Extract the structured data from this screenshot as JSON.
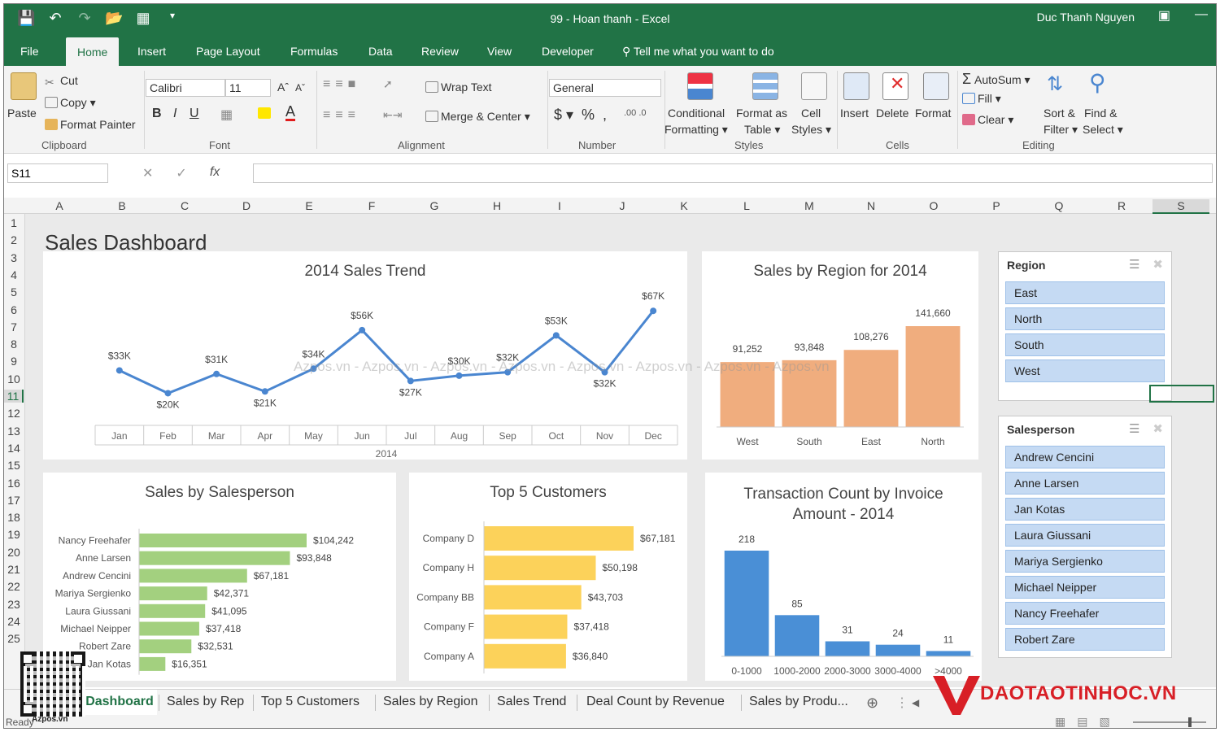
{
  "window": {
    "title": "99 - Hoan thanh - Excel",
    "user": "Duc Thanh Nguyen"
  },
  "ribbon_tabs": [
    "File",
    "Home",
    "Insert",
    "Page Layout",
    "Formulas",
    "Data",
    "Review",
    "View",
    "Developer"
  ],
  "tell_me": "Tell me what you want to do",
  "ribbon": {
    "paste": "Paste",
    "cut": "Cut",
    "copy": "Copy",
    "format_painter": "Format Painter",
    "clipboard": "Clipboard",
    "font_name": "Calibri",
    "font_size": "11",
    "font": "Font",
    "wrap_text": "Wrap Text",
    "merge_center": "Merge & Center",
    "alignment": "Alignment",
    "number_format": "General",
    "number": "Number",
    "conditional_formatting_1": "Conditional",
    "conditional_formatting_2": "Formatting",
    "format_as_table_1": "Format as",
    "format_as_table_2": "Table",
    "cell_styles_1": "Cell",
    "cell_styles_2": "Styles",
    "styles": "Styles",
    "insert": "Insert",
    "delete": "Delete",
    "format": "Format",
    "cells": "Cells",
    "autosum": "AutoSum",
    "fill": "Fill",
    "clear": "Clear",
    "sort_filter_1": "Sort &",
    "sort_filter_2": "Filter",
    "find_select_1": "Find &",
    "find_select_2": "Select",
    "editing": "Editing"
  },
  "formula_bar": {
    "name_box": "S11",
    "fx": "fx",
    "value": ""
  },
  "columns": [
    "A",
    "B",
    "C",
    "D",
    "E",
    "F",
    "G",
    "H",
    "I",
    "J",
    "K",
    "L",
    "M",
    "N",
    "O",
    "P",
    "Q",
    "R",
    "S"
  ],
  "rows": [
    "1",
    "2",
    "3",
    "4",
    "5",
    "6",
    "7",
    "8",
    "9",
    "10",
    "11",
    "12",
    "13",
    "14",
    "15",
    "16",
    "17",
    "18",
    "19",
    "20",
    "21",
    "22",
    "23",
    "24",
    "25"
  ],
  "dashboard_title": "Sales Dashboard",
  "watermark": "Azpos.vn - Azpos.vn - Azpos.vn - Azpos.vn - Azpos.vn - Azpos.vn - Azpos.vn - Azpos.vn",
  "chart_data": [
    {
      "type": "line",
      "title": "2014 Sales Trend",
      "xlabel": "2014",
      "categories": [
        "Jan",
        "Feb",
        "Mar",
        "Apr",
        "May",
        "Jun",
        "Jul",
        "Aug",
        "Sep",
        "Oct",
        "Nov",
        "Dec"
      ],
      "values": [
        33,
        20,
        31,
        21,
        34,
        56,
        27,
        30,
        32,
        53,
        32,
        67
      ],
      "data_labels": [
        "$33K",
        "$20K",
        "$31K",
        "$21K",
        "$34K",
        "$56K",
        "$27K",
        "$30K",
        "$32K",
        "$53K",
        "$32K",
        "$67K"
      ],
      "color": "#4a86d0"
    },
    {
      "type": "bar",
      "title": "Sales by Region for 2014",
      "categories": [
        "West",
        "South",
        "East",
        "North"
      ],
      "values": [
        91252,
        93848,
        108276,
        141660
      ],
      "data_labels": [
        "91,252",
        "93,848",
        "108,276",
        "141,660"
      ],
      "color": "#f0ad7e"
    },
    {
      "type": "bar",
      "orientation": "horizontal",
      "title": "Sales by Salesperson",
      "categories": [
        "Nancy Freehafer",
        "Anne Larsen",
        "Andrew Cencini",
        "Mariya Sergienko",
        "Laura Giussani",
        "Michael Neipper",
        "Robert Zare",
        "Jan Kotas"
      ],
      "values": [
        104242,
        93848,
        67181,
        42371,
        41095,
        37418,
        32531,
        16351
      ],
      "data_labels": [
        "$104,242",
        "$93,848",
        "$67,181",
        "$42,371",
        "$41,095",
        "$37,418",
        "$32,531",
        "$16,351"
      ],
      "color": "#a3d07f"
    },
    {
      "type": "bar",
      "orientation": "horizontal",
      "title": "Top 5 Customers",
      "categories": [
        "Company D",
        "Company H",
        "Company BB",
        "Company F",
        "Company A"
      ],
      "values": [
        67181,
        50198,
        43703,
        37418,
        36840
      ],
      "data_labels": [
        "$67,181",
        "$50,198",
        "$43,703",
        "$37,418",
        "$36,840"
      ],
      "color": "#fcd25a"
    },
    {
      "type": "bar",
      "title": "Transaction Count by Invoice Amount - 2014",
      "categories": [
        "0-1000",
        "1000-2000",
        "2000-3000",
        "3000-4000",
        ">4000"
      ],
      "values": [
        218,
        85,
        31,
        24,
        11
      ],
      "data_labels": [
        "218",
        "85",
        "31",
        "24",
        "11"
      ],
      "color": "#4a8fd6"
    }
  ],
  "slicers": {
    "region": {
      "title": "Region",
      "items": [
        "East",
        "North",
        "South",
        "West"
      ]
    },
    "salesperson": {
      "title": "Salesperson",
      "items": [
        "Andrew Cencini",
        "Anne Larsen",
        "Jan Kotas",
        "Laura Giussani",
        "Mariya Sergienko",
        "Michael Neipper",
        "Nancy Freehafer",
        "Robert Zare"
      ]
    }
  },
  "sheet_tabs": [
    "Dashboard",
    "Sales by Rep",
    "Top 5 Customers",
    "Sales by Region",
    "Sales Trend",
    "Deal Count by Revenue",
    "Sales by Produ..."
  ],
  "status": "Ready",
  "brand": "DAOTAOTINHOC.VN",
  "qr_caption": "Azpos.vn",
  "colors": {
    "excel_green": "#217346",
    "brand_red": "#d81f26"
  }
}
